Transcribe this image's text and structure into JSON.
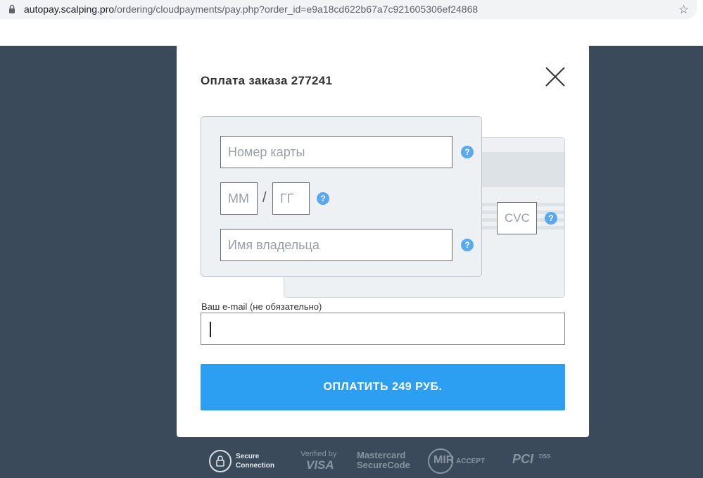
{
  "browser": {
    "url_host": "autopay.scalping.pro",
    "url_path": "/ordering/cloudpayments/pay.php?order_id=e9a18cd622b67a7c921605306ef24868"
  },
  "modal": {
    "title": "Оплата заказа 277241",
    "card_number_placeholder": "Номер карты",
    "month_placeholder": "ММ",
    "separator": "/",
    "year_placeholder": "ГГ",
    "holder_placeholder": "Имя владельца",
    "cvc_placeholder": "CVC",
    "help_glyph": "?",
    "email_label": "Ваш e-mail (не обязательно)",
    "email_value": "",
    "pay_button": "ОПЛАТИТЬ 249 РУБ."
  },
  "footer": {
    "secure_line1": "Secure",
    "secure_line2": "Connection",
    "verified_by": "Verified by",
    "visa": "VISA",
    "mastercard": "Mastercard",
    "securecode": "SecureCode",
    "mir": "MIR",
    "mir_accept": "ACCEPT",
    "pci": "PCI",
    "dss": "DSS"
  },
  "colors": {
    "background": "#3a4a5a",
    "accent": "#2d9ff3",
    "help": "#5aa9ee"
  }
}
